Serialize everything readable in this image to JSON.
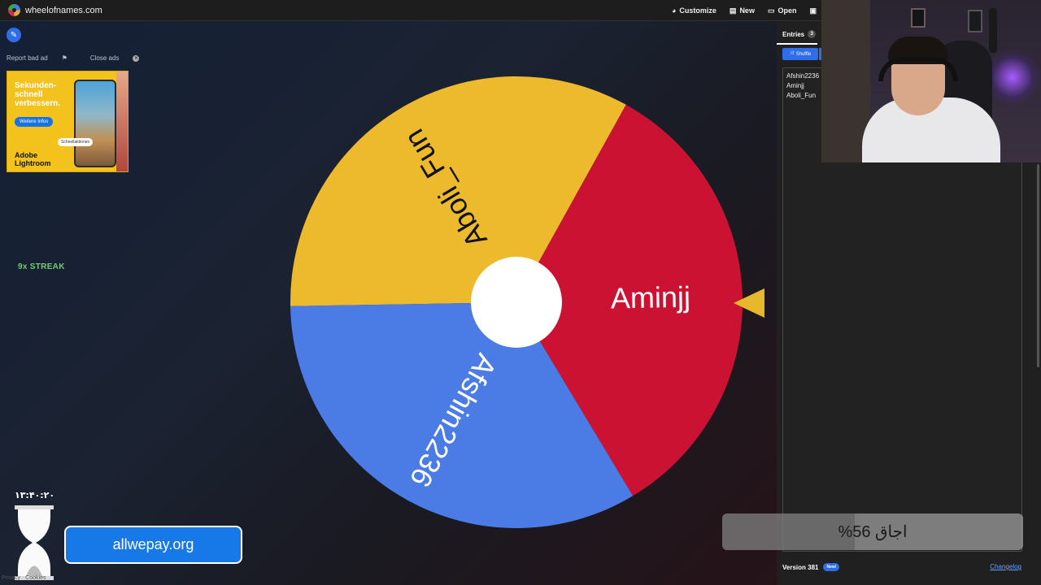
{
  "app": {
    "site_name": "wheelofnames.com"
  },
  "topnav": {
    "items": [
      {
        "icon": "palette-icon",
        "glyph": "◕",
        "label": "Customize"
      },
      {
        "icon": "file-icon",
        "glyph": "▤",
        "label": "New"
      },
      {
        "icon": "folder-icon",
        "glyph": "▭",
        "label": "Open"
      },
      {
        "icon": "save-icon",
        "glyph": "▣",
        "label": ""
      }
    ]
  },
  "ad": {
    "report_label": "Report bad ad",
    "close_label": "Close ads",
    "headline": "Sekunden-schnell verbessern.",
    "button_label": "Weitere Infos",
    "chip_label": "Schnellaktionen",
    "brand": "Adobe Lightroom"
  },
  "streak": "9x STREAK",
  "wheel": {
    "segments": [
      {
        "label": "Aboli_Fun",
        "color": "#ecba2c"
      },
      {
        "label": "Aminjj",
        "color": "#cc1233"
      },
      {
        "label": "Afshin2236",
        "color": "#4b7ce6"
      }
    ],
    "center_color": "#ffffff",
    "pointer_color": "#e8b82c"
  },
  "sidebar": {
    "tab_label": "Entries",
    "entry_count": "3",
    "shuffle_label": "Shuffle",
    "entries": [
      "Afshin2236",
      "Aminjj",
      "Aboli_Fun"
    ],
    "version": "Version 381",
    "new_badge": "New!",
    "changelog": "Changelog"
  },
  "overlay": {
    "progress_text": "اجاق 56%",
    "progress_fraction": 0.44,
    "timer": "۱۳:۴۰:۲۰",
    "donate_label": "allwepay.org",
    "privacy": "Privacy · Cookies"
  },
  "colors": {
    "accent": "#2f6ee8",
    "streak": "#6fcf6a"
  }
}
